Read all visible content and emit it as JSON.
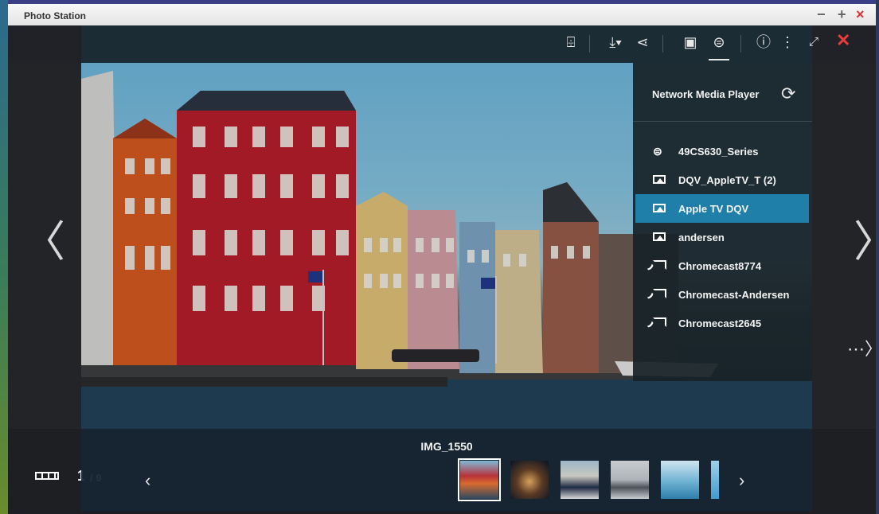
{
  "window": {
    "title": "Photo Station",
    "min": "−",
    "max": "+",
    "close": "×"
  },
  "toolbar": {
    "face_icon": "face-detect-icon",
    "download_icon": "download-icon",
    "share_icon": "share-icon",
    "slideshow_icon": "slideshow-icon",
    "stream_icon": "stream-to-device-icon",
    "info": "ⓘ",
    "more": "⋮",
    "expand": "⤢",
    "close": "✕"
  },
  "nav": {
    "prev": "〈",
    "next": "〉",
    "more": "⋯〉"
  },
  "media_player": {
    "title": "Network Media Player",
    "refresh": "⟳",
    "devices": [
      {
        "label": "49CS630_Series",
        "type": "dlna"
      },
      {
        "label": "DQV_AppleTV_T (2)",
        "type": "airplay"
      },
      {
        "label": "Apple TV DQV",
        "type": "airplay",
        "selected": true
      },
      {
        "label": "andersen",
        "type": "airplay"
      },
      {
        "label": "Chromecast8774",
        "type": "chromecast"
      },
      {
        "label": "Chromecast-Andersen",
        "type": "chromecast"
      },
      {
        "label": "Chromecast2645",
        "type": "chromecast"
      }
    ]
  },
  "footer": {
    "image_name": "IMG_1550",
    "counter_current": "1",
    "counter_total": "/ 9",
    "prev": "‹",
    "next": "›"
  },
  "colors": {
    "accent": "#1f7fa9",
    "close": "#e03131"
  }
}
